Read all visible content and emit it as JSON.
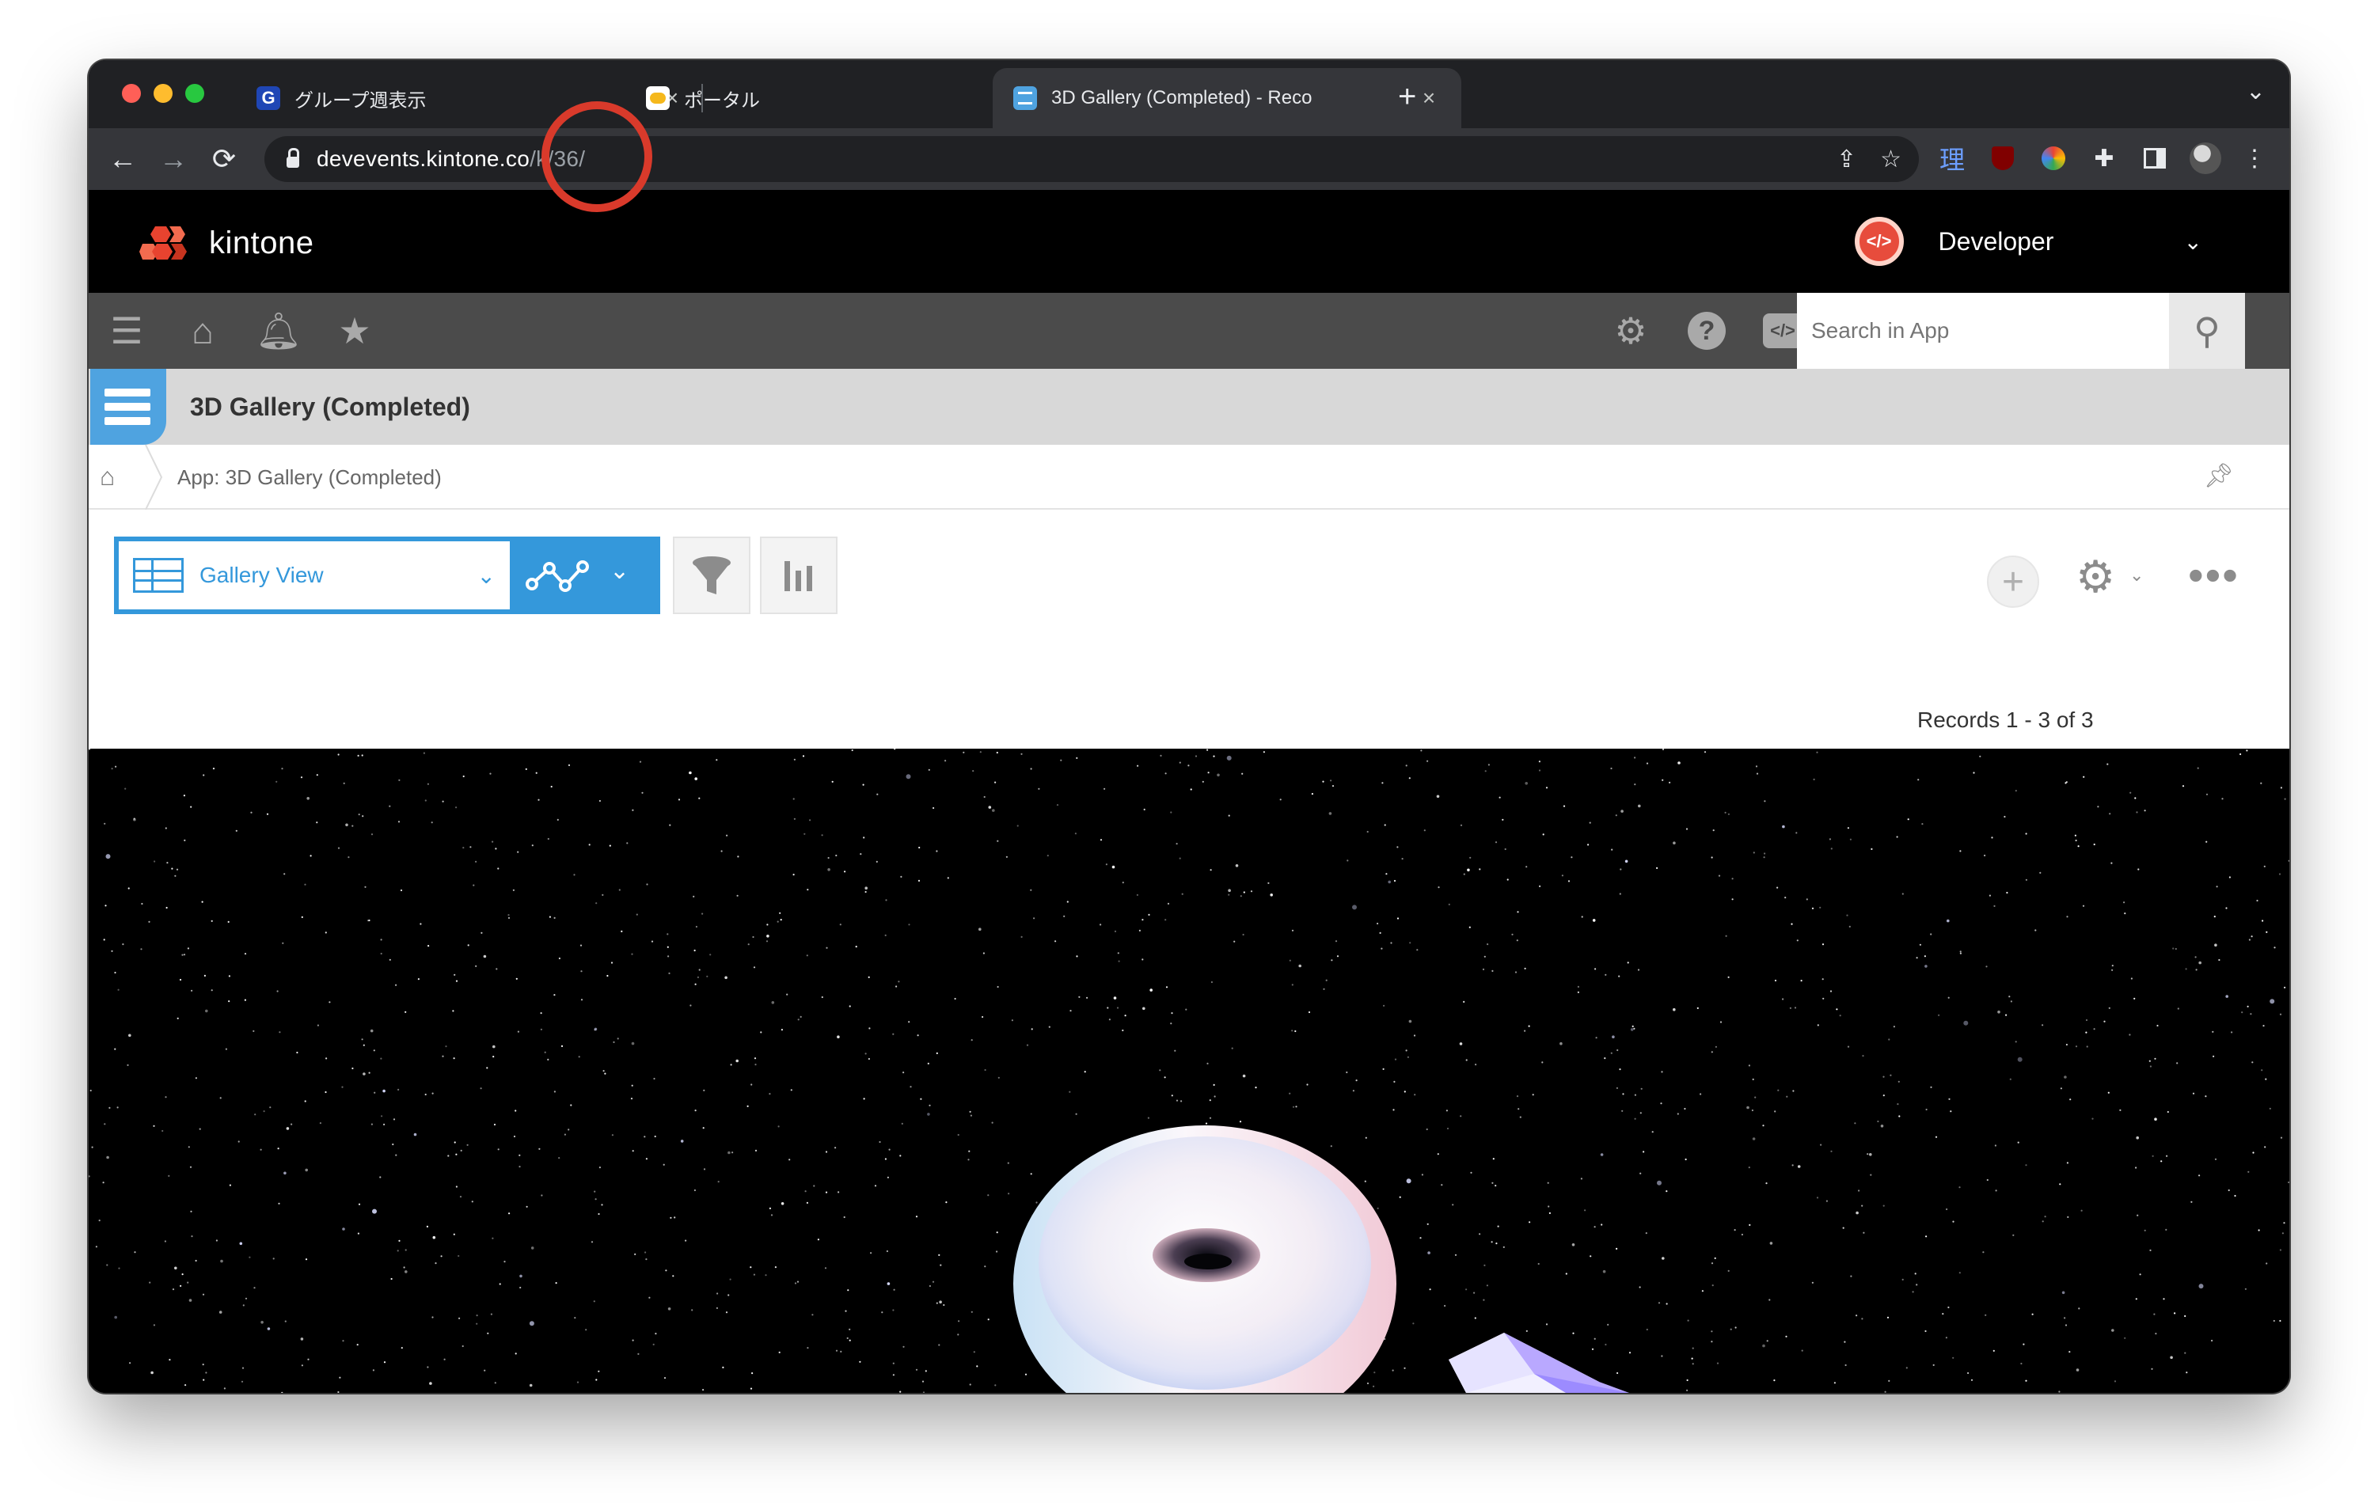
{
  "browser": {
    "tabs": [
      {
        "favicon": "G",
        "title": "グループ週表示"
      },
      {
        "favicon": "portal-icon",
        "title": "ポータル"
      },
      {
        "favicon": "kintone-app-icon",
        "title": "3D Gallery (Completed) - Reco"
      }
    ],
    "url_host": "devevents.kintone.co",
    "url_path": "/k/36/",
    "annotation_color": "#d93a2b"
  },
  "kintone": {
    "brand": "kintone",
    "user": {
      "name": "Developer"
    },
    "search": {
      "placeholder": "Search in App"
    },
    "app": {
      "title": "3D Gallery (Completed)"
    },
    "breadcrumb": {
      "label": "App: 3D Gallery (Completed)"
    },
    "view": {
      "selected": "Gallery View"
    },
    "records_summary": "Records 1 - 3 of 3",
    "accent": "#3498db"
  }
}
